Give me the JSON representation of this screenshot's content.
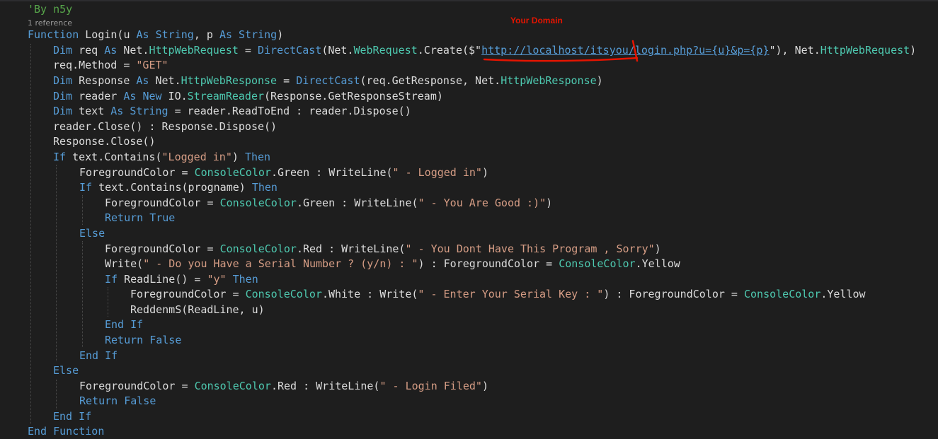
{
  "codelens": {
    "references": "1 reference"
  },
  "annotation": {
    "label": "Your Domain",
    "color": "#e51400"
  },
  "code": {
    "l0": [
      "'By n5y"
    ],
    "l1": [
      "Function",
      " Login(u ",
      "As",
      " ",
      "String",
      ", p ",
      "As",
      " ",
      "String",
      ")"
    ],
    "l2": [
      "Dim",
      " req ",
      "As",
      " Net.",
      "HttpWebRequest",
      " = ",
      "DirectCast",
      "(Net.",
      "WebRequest",
      ".Create($\"",
      "http://localhost/itsyou/login.php?u={u}&p={p}",
      "\"), Net.",
      "HttpWebRequest",
      ")"
    ],
    "l3": [
      "req.Method = ",
      "\"GET\""
    ],
    "l4": [
      "Dim",
      " Response ",
      "As",
      " Net.",
      "HttpWebResponse",
      " = ",
      "DirectCast",
      "(req.GetResponse, Net.",
      "HttpWebResponse",
      ")"
    ],
    "l5": [
      "Dim",
      " reader ",
      "As",
      " ",
      "New",
      " IO.",
      "StreamReader",
      "(Response.GetResponseStream)"
    ],
    "l6": [
      "Dim",
      " text ",
      "As",
      " ",
      "String",
      " = reader.ReadToEnd : reader.Dispose()"
    ],
    "l7": [
      "reader.Close() : Response.Dispose()"
    ],
    "l8": [
      "Response.Close()"
    ],
    "l9": [
      "If",
      " text.Contains(",
      "\"Logged in\"",
      ") ",
      "Then"
    ],
    "l10": [
      "ForegroundColor = ",
      "ConsoleColor",
      ".Green : WriteLine(",
      "\" - Logged in\"",
      ")"
    ],
    "l11": [
      "If",
      " text.Contains(progname) ",
      "Then"
    ],
    "l12": [
      "ForegroundColor = ",
      "ConsoleColor",
      ".Green : WriteLine(",
      "\" - You Are Good :)\"",
      ")"
    ],
    "l13": [
      "Return",
      " ",
      "True"
    ],
    "l14": [
      "Else"
    ],
    "l15": [
      "ForegroundColor = ",
      "ConsoleColor",
      ".Red : WriteLine(",
      "\" - You Dont Have This Program , Sorry\"",
      ")"
    ],
    "l16": [
      "Write(",
      "\" - Do you Have a Serial Number ? (y/n) : \"",
      ") : ForegroundColor = ",
      "ConsoleColor",
      ".Yellow"
    ],
    "l17": [
      "If",
      " ReadLine() = ",
      "\"y\"",
      " ",
      "Then"
    ],
    "l18": [
      "ForegroundColor = ",
      "ConsoleColor",
      ".White : Write(",
      "\" - Enter Your Serial Key : \"",
      ") : ForegroundColor = ",
      "ConsoleColor",
      ".Yellow"
    ],
    "l19": [
      "ReddenmS(ReadLine, u)"
    ],
    "l20": [
      "End",
      " ",
      "If"
    ],
    "l21": [
      "Return",
      " ",
      "False"
    ],
    "l22": [
      "End",
      " ",
      "If"
    ],
    "l23": [
      "Else"
    ],
    "l24": [
      "ForegroundColor = ",
      "ConsoleColor",
      ".Red : WriteLine(",
      "\" - Login Filed\"",
      ")"
    ],
    "l25": [
      "Return",
      " ",
      "False"
    ],
    "l26": [
      "End",
      " ",
      "If"
    ],
    "l27": [
      "End",
      " ",
      "Function"
    ]
  },
  "colors": {
    "background": "#1e1e1e",
    "keyword": "#569cd6",
    "string": "#d69d85",
    "type": "#4ec9b0",
    "comment": "#57a64a",
    "text": "#dcdcdc"
  }
}
